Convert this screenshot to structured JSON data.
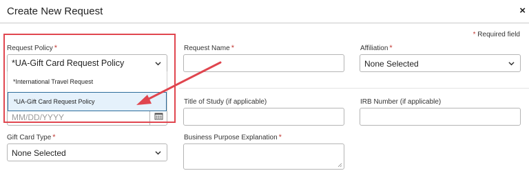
{
  "header": {
    "title": "Create New Request",
    "close_symbol": "×"
  },
  "required_legend": {
    "star": "*",
    "text": "Required field"
  },
  "fields": {
    "request_policy": {
      "label": "Request Policy",
      "star": "*",
      "value": "*UA-Gift Card Request Policy"
    },
    "request_name": {
      "label": "Request Name",
      "star": "*",
      "value": ""
    },
    "affiliation": {
      "label": "Affiliation",
      "star": "*",
      "value": "None Selected"
    },
    "date": {
      "placeholder": "MM/DD/YYYY"
    },
    "title_of_study": {
      "label": "Title of Study (if applicable)",
      "value": ""
    },
    "irb_number": {
      "label": "IRB Number (if applicable)",
      "value": ""
    },
    "gift_card_type": {
      "label": "Gift Card Type",
      "star": "*",
      "value": "None Selected"
    },
    "business_purpose": {
      "label": "Business Purpose Explanation",
      "star": "*",
      "value": ""
    }
  },
  "dropdown": {
    "options": [
      "*International Travel Request",
      "*UA-Gift Card Request Policy"
    ],
    "selected_index": 1
  },
  "colors": {
    "annotation": "#e0454e",
    "required": "#c23934",
    "selected_bg": "#e5f1fb"
  }
}
